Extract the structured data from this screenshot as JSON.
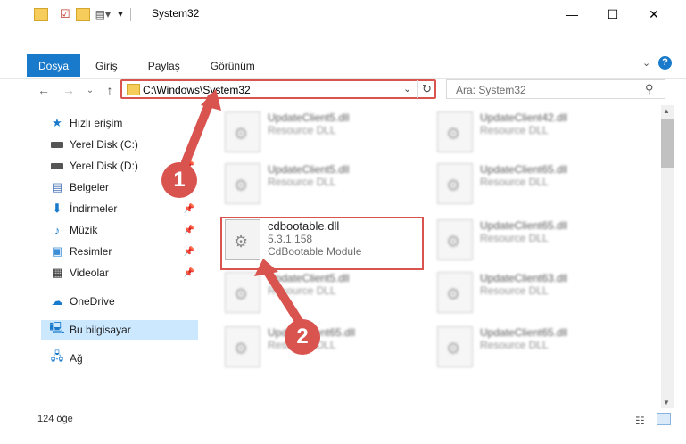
{
  "window": {
    "title": "System32",
    "minimize": "—",
    "maximize": "☐",
    "close": "✕"
  },
  "ribbon": {
    "tabs": [
      "Dosya",
      "Giriş",
      "Paylaş",
      "Görünüm"
    ]
  },
  "address": {
    "path": "C:\\Windows\\System32"
  },
  "search": {
    "placeholder": "Ara: System32"
  },
  "sidebar": {
    "items": [
      {
        "label": "Hızlı erişim",
        "icon": "star-icon"
      },
      {
        "label": "Yerel Disk (C:)",
        "icon": "drive-icon"
      },
      {
        "label": "Yerel Disk (D:)",
        "icon": "drive-icon"
      },
      {
        "label": "Belgeler",
        "icon": "documents-icon"
      },
      {
        "label": "İndirmeler",
        "icon": "download-icon"
      },
      {
        "label": "Müzik",
        "icon": "music-icon"
      },
      {
        "label": "Resimler",
        "icon": "pictures-icon"
      },
      {
        "label": "Videolar",
        "icon": "videos-icon"
      },
      {
        "label": "OneDrive",
        "icon": "cloud-icon"
      },
      {
        "label": "Bu bilgisayar",
        "icon": "computer-icon"
      },
      {
        "label": "Ağ",
        "icon": "network-icon"
      }
    ]
  },
  "files": {
    "left": [
      {
        "name": "UpdateClient5.dll",
        "desc": "Resource DLL"
      },
      {
        "name": "UpdateClient5.dll",
        "desc": "Resource DLL"
      },
      {
        "name": "UpdateClient5.dll",
        "desc": "Resource DLL"
      },
      {
        "name": "UpdateClient65.dll",
        "desc": "Resource DLL"
      }
    ],
    "right": [
      {
        "name": "UpdateClient42.dll",
        "desc": "Resource DLL"
      },
      {
        "name": "UpdateClient65.dll",
        "desc": "Resource DLL"
      },
      {
        "name": "UpdateClient65.dll",
        "desc": "Resource DLL"
      },
      {
        "name": "UpdateClient63.dll",
        "desc": "Resource DLL"
      },
      {
        "name": "UpdateClient65.dll",
        "desc": "Resource DLL"
      }
    ],
    "selected": {
      "name": "cdbootable.dll",
      "version": "5.3.1.158",
      "desc": "CdBootable Module"
    }
  },
  "status": {
    "count": "124 öğe"
  },
  "callouts": [
    "1",
    "2"
  ],
  "colors": {
    "accent": "#1979ca",
    "highlight": "#d9534f"
  }
}
